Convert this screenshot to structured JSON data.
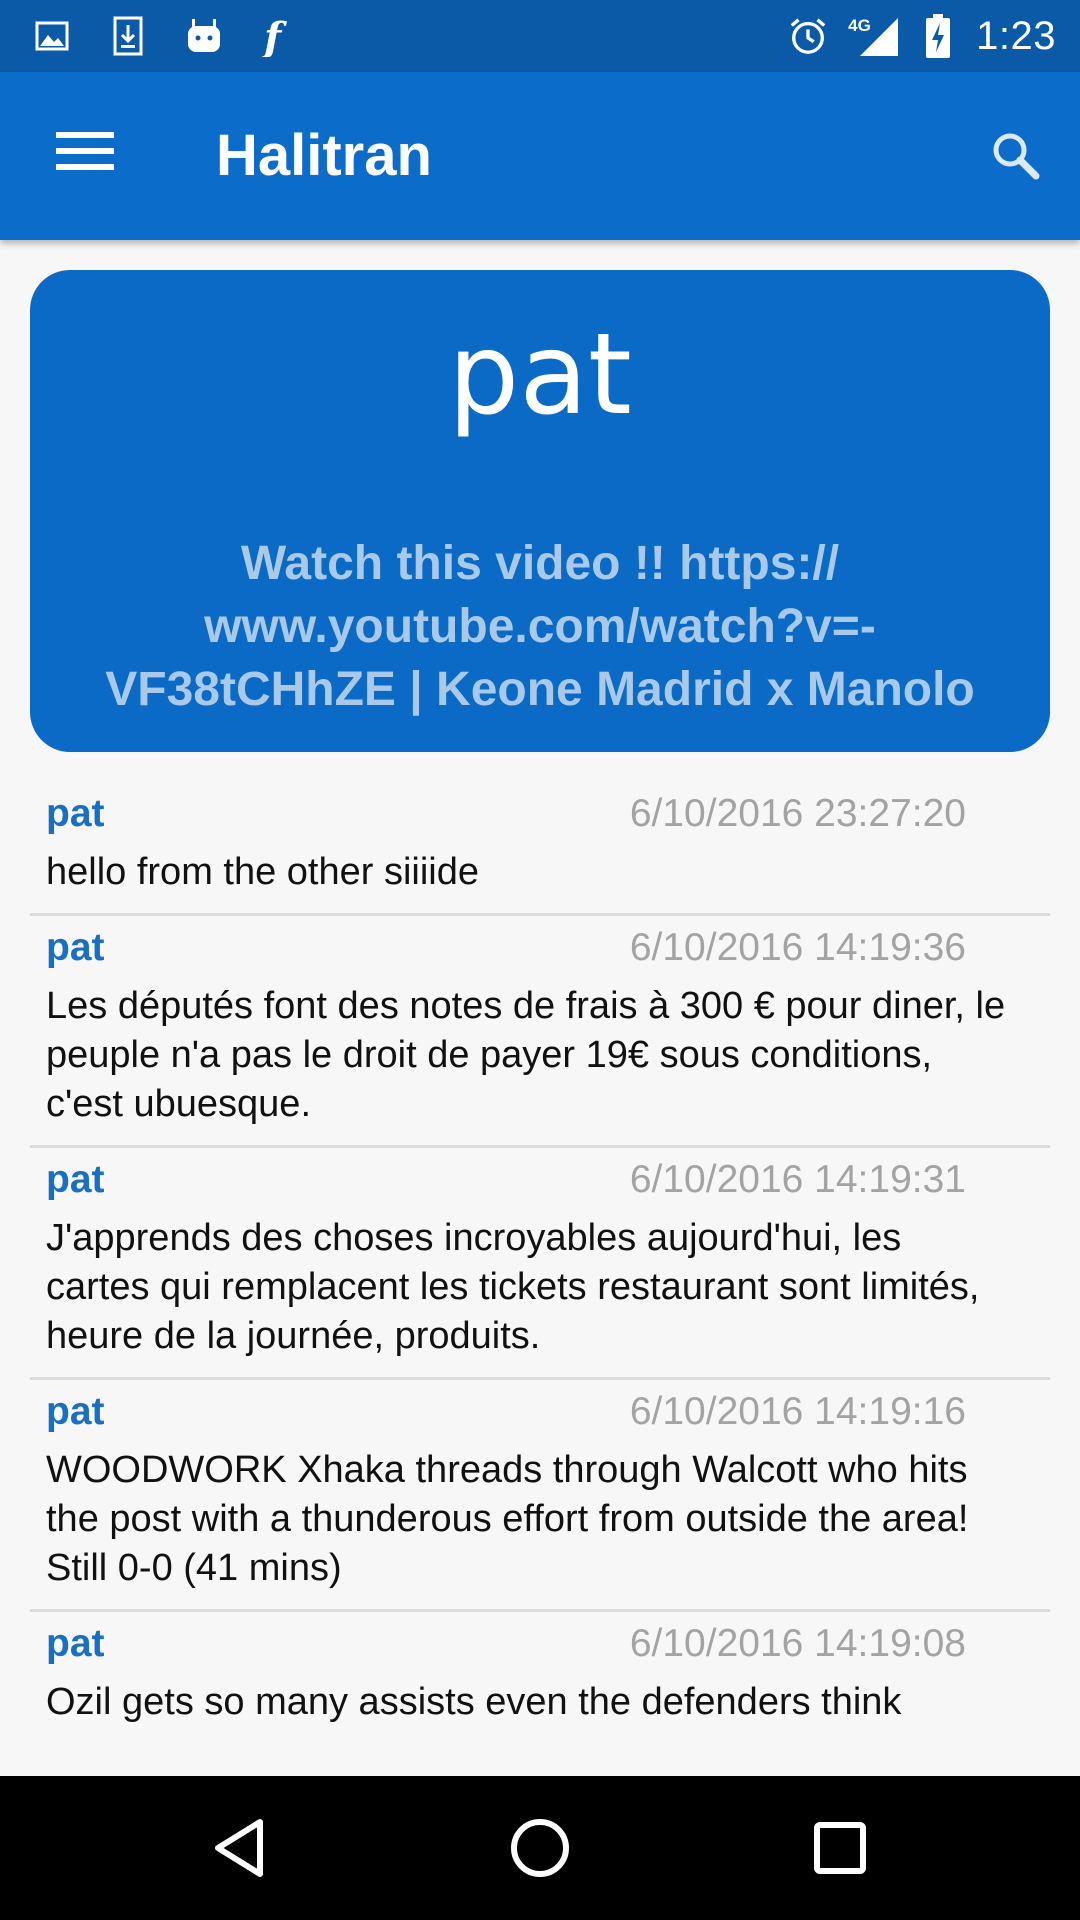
{
  "status_bar": {
    "left_icons": [
      "image-icon",
      "download-icon",
      "android-icon",
      "fantasy-app-icon"
    ],
    "right_icons": [
      "alarm-icon",
      "signal-4g-icon",
      "battery-charging-icon"
    ],
    "network_label": "4G",
    "time": "1:23"
  },
  "app_bar": {
    "title": "Halitran",
    "menu_icon": "hamburger-menu-icon",
    "search_icon": "search-icon"
  },
  "featured": {
    "author": "pat",
    "message": "Watch this video !! https:// www.youtube.com/watch?v=-VF38tCHhZE | Keone Madrid x Manolo"
  },
  "messages": [
    {
      "user": "pat",
      "time": "6/10/2016 23:27:20",
      "text": "hello from the other siiiide"
    },
    {
      "user": "pat",
      "time": "6/10/2016 14:19:36",
      "text": "Les députés font des notes de frais à 300 € pour diner, le peuple n'a pas le droit de payer   19€ sous conditions, c'est ubuesque."
    },
    {
      "user": "pat",
      "time": "6/10/2016 14:19:31",
      "text": "J'apprends des choses incroyables aujourd'hui, les cartes qui remplacent les tickets restaurant sont limités, heure de la journée, produits."
    },
    {
      "user": "pat",
      "time": "6/10/2016 14:19:16",
      "text": "WOODWORK Xhaka threads through Walcott who hits the post with a thunderous effort from outside the area! Still 0-0 (41 mins)"
    },
    {
      "user": "pat",
      "time": "6/10/2016 14:19:08",
      "text": "Ozil gets so many assists even the defenders think"
    }
  ],
  "nav_bar": {
    "icons": [
      "back-icon",
      "home-icon",
      "recents-icon"
    ]
  }
}
